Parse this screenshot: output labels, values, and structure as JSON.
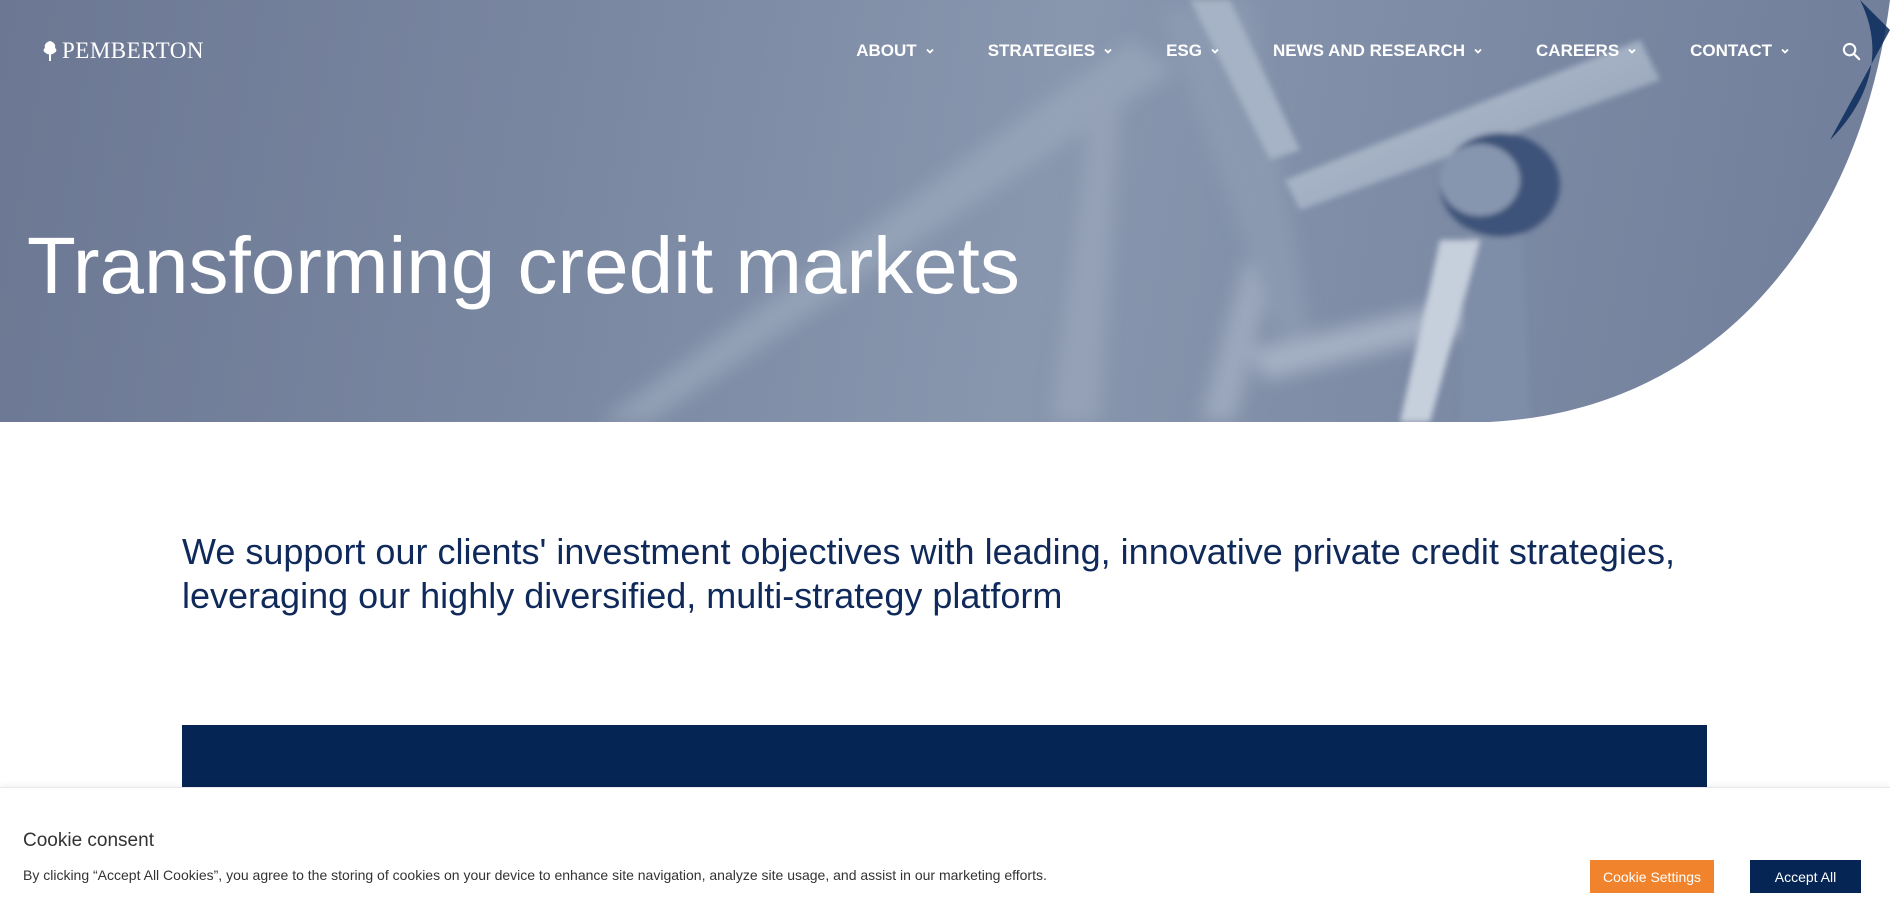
{
  "brand": {
    "logo_text": "PEMBERTON",
    "logo_icon": "tree-icon"
  },
  "nav": {
    "items": [
      {
        "label": "ABOUT"
      },
      {
        "label": "STRATEGIES"
      },
      {
        "label": "ESG"
      },
      {
        "label": "NEWS AND RESEARCH"
      },
      {
        "label": "CAREERS"
      },
      {
        "label": "CONTACT"
      }
    ],
    "search_icon": "search-icon"
  },
  "hero": {
    "title": "Transforming credit markets"
  },
  "intro": {
    "text": "We support our clients' investment objectives with leading, innovative private credit strategies, leveraging our highly diversified, multi-strategy platform"
  },
  "cookie": {
    "title": "Cookie consent",
    "text": "By clicking “Accept All Cookies”, you agree to the storing of cookies on your device to enhance site navigation, analyze site usage, and assist in our marketing efforts.",
    "settings_label": "Cookie Settings",
    "accept_label": "Accept All"
  },
  "colors": {
    "navy": "#052554",
    "orange": "#f0832b",
    "intro_text": "#0f2a5a"
  }
}
